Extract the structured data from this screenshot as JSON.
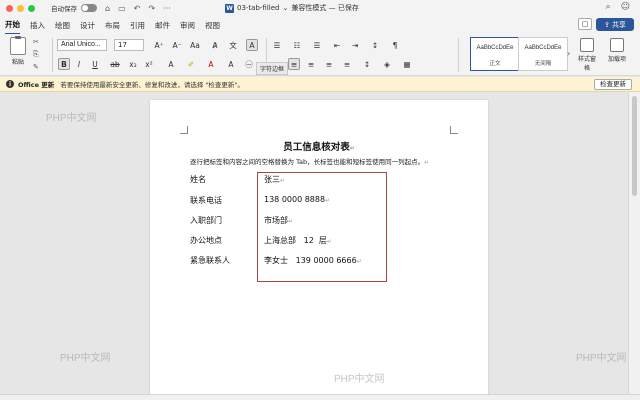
{
  "titlebar": {
    "autosave_label": "自动保存",
    "doc_name": "03-tab-filled",
    "doc_status": "兼容性模式 — 已保存",
    "doc_icon": "W"
  },
  "tabs": [
    "开始",
    "插入",
    "绘图",
    "设计",
    "布局",
    "引用",
    "邮件",
    "审阅",
    "视图"
  ],
  "share_label": "共享",
  "ribbon": {
    "paste_label": "粘贴",
    "font_name": "Arial Unico...",
    "font_size": "17",
    "tooltip": "字符边框",
    "styles": [
      {
        "sample": "AaBbCcDdEe",
        "name": "正文"
      },
      {
        "sample": "AaBbCcDdEe",
        "name": "无间隔"
      }
    ],
    "style_pane_label": "样式窗格",
    "addins_label": "加载项"
  },
  "notice": {
    "title": "Office 更新",
    "text": "若要保持使用最新安全更新、修复和改进，请选择 \"检查更新\"。",
    "button": "检查更新"
  },
  "document": {
    "heading": "员工信息核对表",
    "intro": "逐行把标签和内容之间的空格替换为 Tab，长标签也能和短标签使用同一列起点。",
    "rows": [
      {
        "label": "姓名",
        "value": "张三"
      },
      {
        "label": "联系电话",
        "value": "138 0000 8888"
      },
      {
        "label": "入职部门",
        "value": "市场部"
      },
      {
        "label": "办公地点",
        "value": "上海总部   12  层"
      },
      {
        "label": "紧急联系人",
        "value": "李女士   139 0000 6666"
      }
    ]
  },
  "watermarks": [
    "PHP中文网",
    "PHP中文网",
    "PHP中文网",
    "PHP中文网"
  ],
  "colors": {
    "accent": "#2b579a",
    "highlight_box": "#a8454a",
    "notice_bg": "#fdf2d1"
  }
}
